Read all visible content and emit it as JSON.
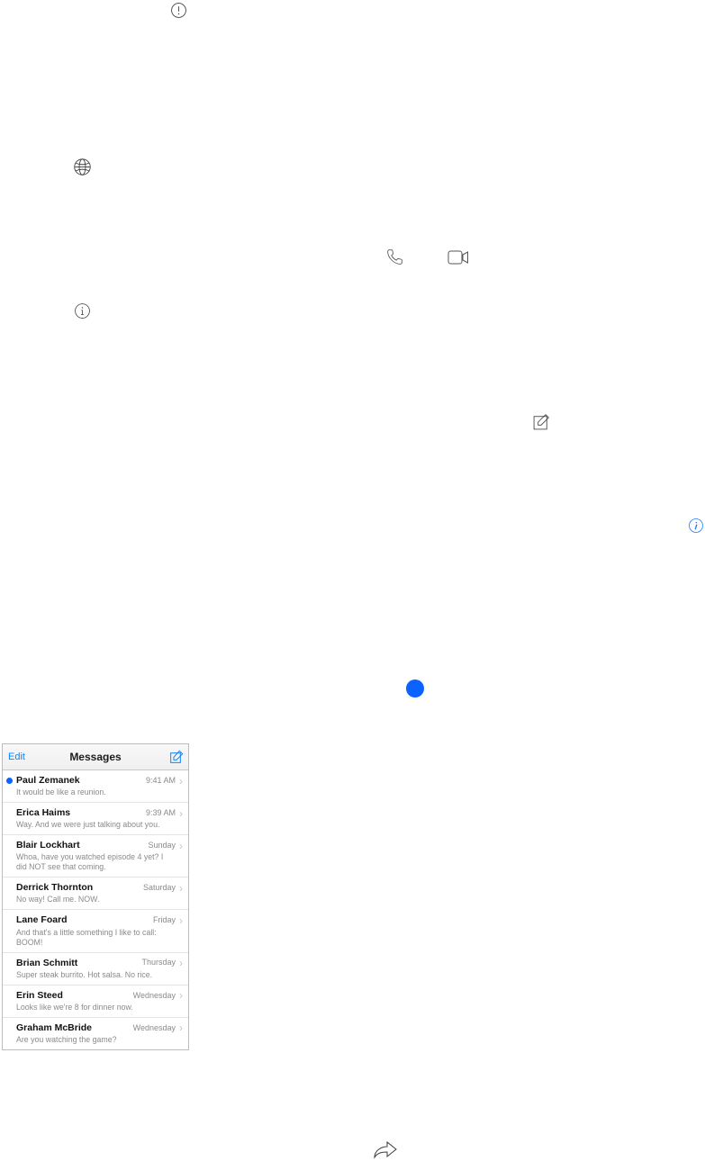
{
  "messages_panel": {
    "edit_label": "Edit",
    "title": "Messages",
    "rows": [
      {
        "unread": true,
        "name": "Paul Zemanek",
        "time": "9:41 AM",
        "preview": "It would be like a reunion."
      },
      {
        "unread": false,
        "name": "Erica Haims",
        "time": "9:39 AM",
        "preview": "Way. And we were just talking about you."
      },
      {
        "unread": false,
        "name": "Blair Lockhart",
        "time": "Sunday",
        "preview": "Whoa, have you watched episode 4 yet? I did NOT see that coming."
      },
      {
        "unread": false,
        "name": "Derrick Thornton",
        "time": "Saturday",
        "preview": "No way! Call me. NOW."
      },
      {
        "unread": false,
        "name": "Lane Foard",
        "time": "Friday",
        "preview": "And that's a little something I like to call: BOOM!"
      },
      {
        "unread": false,
        "name": "Brian Schmitt",
        "time": "Thursday",
        "preview": "Super steak burrito. Hot salsa. No rice."
      },
      {
        "unread": false,
        "name": "Erin Steed",
        "time": "Wednesday",
        "preview": "Looks like we're 8 for dinner now."
      },
      {
        "unread": false,
        "name": "Graham McBride",
        "time": "Wednesday",
        "preview": "Are you watching the game?"
      }
    ]
  }
}
